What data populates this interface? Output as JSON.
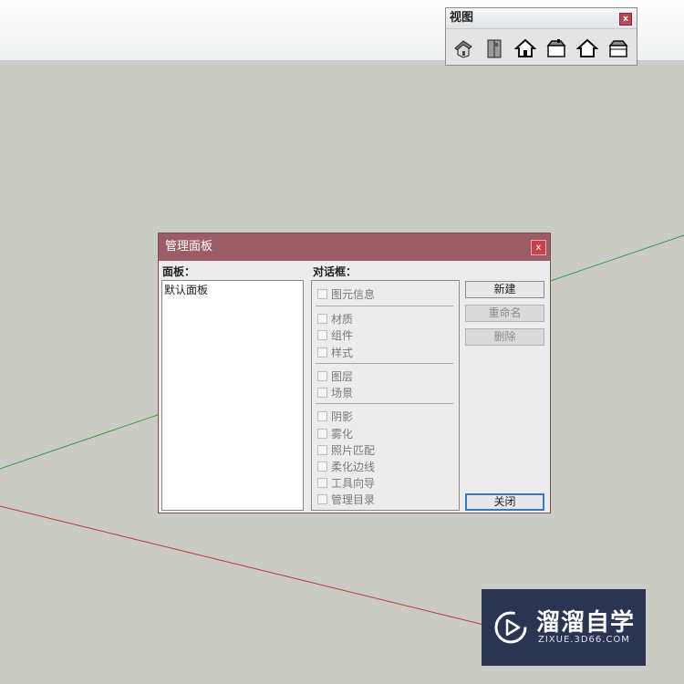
{
  "views_toolbar": {
    "title": "视图",
    "close_label": "x",
    "icons": [
      "iso-view-icon",
      "top-view-icon",
      "front-view-icon",
      "right-view-icon",
      "back-view-icon",
      "left-view-icon"
    ]
  },
  "dialog": {
    "title": "管理面板",
    "close_label": "x",
    "trays_label": "面板：",
    "dialogs_label": "对话框：",
    "trays": [
      "默认面板"
    ],
    "group1": [
      "图元信息"
    ],
    "group2": [
      "材质",
      "组件",
      "样式"
    ],
    "group3": [
      "图层",
      "场景"
    ],
    "group4": [
      "阴影",
      "雾化",
      "照片匹配",
      "柔化边线",
      "工具向导",
      "管理目录"
    ],
    "buttons": {
      "new": "新建",
      "rename": "重命名",
      "delete": "删除",
      "close": "关闭"
    }
  },
  "watermark": {
    "title": "溜溜自学",
    "subtitle": "ZIXUE.3D66.COM"
  },
  "colors": {
    "dialog_title_bar": "#9c5d66",
    "ground": "#cbcbc6",
    "green_axis": "#3c9a3c",
    "red_axis": "#b23a3a",
    "watermark_bg": "#2b3552"
  }
}
